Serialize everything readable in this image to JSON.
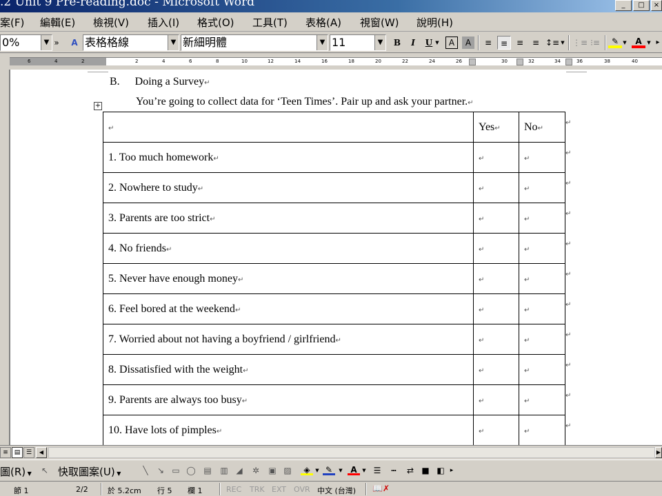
{
  "window": {
    "title": ".2 Unit 9 Pre-reading.doc - Microsoft Word"
  },
  "menu": [
    "案(F)",
    "編輯(E)",
    "檢視(V)",
    "插入(I)",
    "格式(O)",
    "工具(T)",
    "表格(A)",
    "視窗(W)",
    "說明(H)"
  ],
  "toolbar": {
    "zoom": "0%",
    "style": "表格格線",
    "font": "新細明體",
    "size": "11",
    "bold": "B",
    "italic": "I",
    "underline": "U"
  },
  "ruler": [
    "6",
    "4",
    "2",
    "2",
    "4",
    "6",
    "8",
    "10",
    "12",
    "14",
    "16",
    "18",
    "20",
    "22",
    "24",
    "26",
    "30",
    "32",
    "34",
    "36",
    "38",
    "40"
  ],
  "document": {
    "section_label": "B.",
    "section_title": "Doing a Survey",
    "instruction": "You’re going to collect data for ‘Teen Times’.    Pair up and ask your partner.",
    "paragraph_mark": "↵",
    "headers": [
      "",
      "Yes",
      "No"
    ],
    "rows": [
      "1. Too much homework",
      "2. Nowhere to study",
      "3. Parents are too strict",
      "4. No friends",
      "5. Never have enough money",
      "6. Feel bored at the weekend",
      "7. Worried about not having a boyfriend / girlfriend",
      "8. Dissatisfied with the weight",
      "9. Parents are always too busy",
      "10. Have lots of pimples"
    ]
  },
  "drawing_toolbar": {
    "draw": "圖(R)",
    "autoshapes": "快取圖案(U)"
  },
  "status": {
    "section": "節 1",
    "page": "2/2",
    "at": "於 5.2cm",
    "line": "行 5",
    "column": "欄 1",
    "rec": "REC",
    "trk": "TRK",
    "ext": "EXT",
    "ovr": "OVR",
    "language": "中文 (台灣)"
  },
  "colors": {
    "titlebar": "#0a246a",
    "chrome": "#d4d0c8",
    "page": "#ffffff",
    "highlight": "#ffff00",
    "font_color": "#ff0000"
  }
}
